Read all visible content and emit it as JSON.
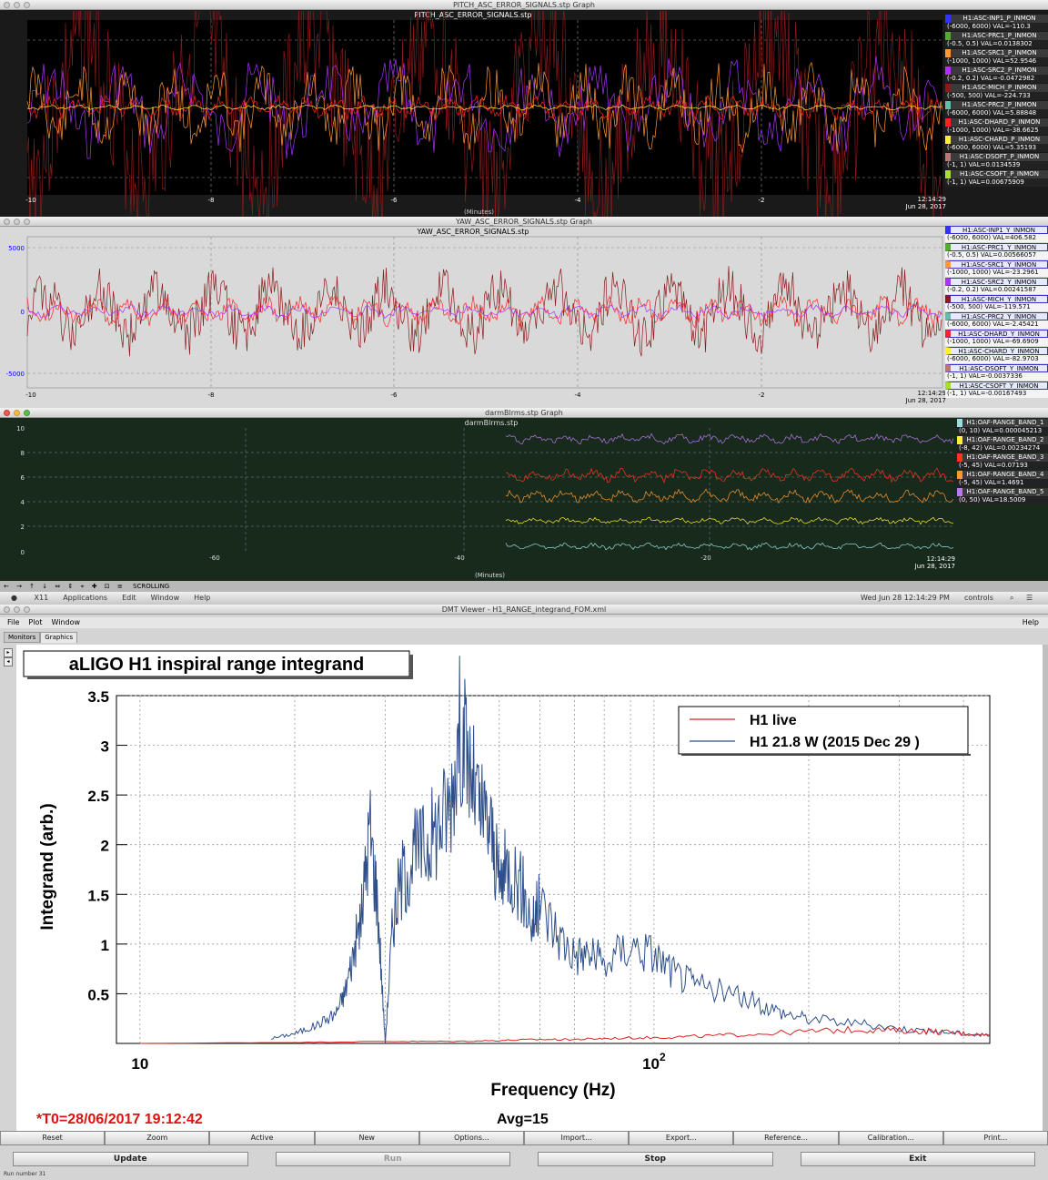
{
  "pitch_window": {
    "title": "PITCH_ASC_ERROR_SIGNALS.stp Graph",
    "plot_title": "PITCH_ASC_ERROR_SIGNALS.stp",
    "x_ticks": [
      "-10",
      "-8",
      "-6",
      "-4",
      "-2"
    ],
    "timestamp": "12:14:29",
    "date": "Jun 28, 2017",
    "x_unit": "(Minutes)",
    "legend": [
      {
        "name": "H1:ASC-INP1_P_INMON",
        "val": "(-6000, 6000) VAL=-110.3",
        "color": "#3333ff"
      },
      {
        "name": "H1:ASC-PRC1_P_INMON",
        "val": "(-0.5, 0.5) VAL=0.0138302",
        "color": "#55aa33"
      },
      {
        "name": "H1:ASC-SRC1_P_INMON",
        "val": "(-1000, 1000) VAL=52.9546",
        "color": "#ff9933"
      },
      {
        "name": "H1:ASC-SRC2_P_INMON",
        "val": "(-0.2, 0.2) VAL=-0.0472982",
        "color": "#aa33ff"
      },
      {
        "name": "H1:ASC-MICH_P_INMON",
        "val": "(-500, 500) VAL=-224.733",
        "color": "#8b1a1a"
      },
      {
        "name": "H1:ASC-PRC2_P_INMON",
        "val": "(-6000, 6000) VAL=5.88848",
        "color": "#66bbaa"
      },
      {
        "name": "H1:ASC-DHARD_P_INMON",
        "val": "(-1000, 1000) VAL=-38.6625",
        "color": "#ff2222"
      },
      {
        "name": "H1:ASC-CHARD_P_INMON",
        "val": "(-6000, 6000) VAL=5.35193",
        "color": "#ffee33"
      },
      {
        "name": "H1:ASC-DSOFT_P_INMON",
        "val": "(-1, 1) VAL=0.0134539",
        "color": "#bb7777"
      },
      {
        "name": "H1:ASC-CSOFT_P_INMON",
        "val": "(-1, 1) VAL=0.00675909",
        "color": "#aadd33"
      }
    ]
  },
  "yaw_window": {
    "title": "YAW_ASC_ERROR_SIGNALS.stp Graph",
    "plot_title": "YAW_ASC_ERROR_SIGNALS.stp",
    "y_ticks": [
      "5000",
      "0",
      "-5000"
    ],
    "x_ticks": [
      "-10",
      "-8",
      "-6",
      "-4",
      "-2"
    ],
    "timestamp": "12:14:29",
    "date": "Jun 28, 2017",
    "legend": [
      {
        "name": "H1:ASC-INP1_Y_INMON",
        "val": "(-6000, 6000) VAL=406.582",
        "color": "#3333ff"
      },
      {
        "name": "H1:ASC-PRC1_Y_INMON",
        "val": "(-0.5, 0.5) VAL=0.00566057",
        "color": "#55aa33"
      },
      {
        "name": "H1:ASC-SRC1_Y_INMON",
        "val": "(-1000, 1000) VAL=-23.2961",
        "color": "#ff9933"
      },
      {
        "name": "H1:ASC-SRC2_Y_INMON",
        "val": "(-0.2, 0.2) VAL=0.00241587",
        "color": "#aa33ff"
      },
      {
        "name": "H1:ASC-MICH_Y_INMON",
        "val": "(-500, 500) VAL=-119.571",
        "color": "#8b1a1a"
      },
      {
        "name": "H1:ASC-PRC2_Y_INMON",
        "val": "(-6000, 6000) VAL=-2.45421",
        "color": "#66bbaa"
      },
      {
        "name": "H1:ASC-DHARD_Y_INMON",
        "val": "(-1000, 1000) VAL=-69.6909",
        "color": "#ff2222"
      },
      {
        "name": "H1:ASC-CHARD_Y_INMON",
        "val": "(-6000, 6000) VAL=-82.9703",
        "color": "#ffee33"
      },
      {
        "name": "H1:ASC-DSOFT_Y_INMON",
        "val": "(-1, 1) VAL=-0.0037336",
        "color": "#bb7777"
      },
      {
        "name": "H1:ASC-CSOFT_Y_INMON",
        "val": "(-1, 1) VAL=-0.00167493",
        "color": "#aadd33"
      }
    ]
  },
  "darm_window": {
    "title": "darmBlrms.stp Graph",
    "plot_title": "darmBlrms.stp",
    "y_ticks": [
      "10",
      "8",
      "6",
      "4",
      "2",
      "0"
    ],
    "x_ticks": [
      "-60",
      "-40",
      "-20"
    ],
    "timestamp": "12:14:29",
    "date": "Jun 28, 2017",
    "x_unit": "(Minutes)",
    "legend": [
      {
        "name": "H1:OAF-RANGE_BAND_1",
        "val": "(0, 10) VAL=0.000045213",
        "color": "#99dddd"
      },
      {
        "name": "H1:OAF-RANGE_BAND_2",
        "val": "(-8, 42) VAL=0.00234274",
        "color": "#ffee33"
      },
      {
        "name": "H1:OAF-RANGE_BAND_3",
        "val": "(-5, 45) VAL=0.07193",
        "color": "#ff3322"
      },
      {
        "name": "H1:OAF-RANGE_BAND_4",
        "val": "(-5, 45) VAL=1.4691",
        "color": "#ff9933"
      },
      {
        "name": "H1:OAF-RANGE_BAND_5",
        "val": "(0, 50) VAL=18.5009",
        "color": "#bb77ee"
      }
    ],
    "toolbar_label": "SCROLLING"
  },
  "mac_menubar": {
    "items": [
      "X11",
      "Applications",
      "Edit",
      "Window",
      "Help"
    ],
    "clock": "Wed Jun 28 12:14:29 PM",
    "user": "controls"
  },
  "dmt_window": {
    "title": "DMT Viewer - H1_RANGE_integrand_FOM.xml",
    "menu": [
      "File",
      "Plot",
      "Window"
    ],
    "help": "Help",
    "tabs": [
      "Monitors",
      "Graphics"
    ],
    "plot_title": "aLIGO H1 inspiral range integrand",
    "xlabel": "Frequency (Hz)",
    "ylabel": "Integrand (arb.)",
    "t0": "*T0=28/06/2017 19:12:42",
    "avg": "Avg=15",
    "buttons_row1": [
      "Reset",
      "Zoom",
      "Active",
      "New",
      "Options...",
      "Import...",
      "Export...",
      "Reference...",
      "Calibration...",
      "Print..."
    ],
    "buttons_row2": [
      "Update",
      "Run",
      "Stop",
      "Exit"
    ],
    "status": "Run number 31"
  },
  "chart_data": {
    "type": "line",
    "title": "aLIGO H1 inspiral range integrand",
    "xlabel": "Frequency (Hz)",
    "ylabel": "Integrand (arb.)",
    "xscale": "log",
    "xlim": [
      9,
      450
    ],
    "ylim": [
      0,
      3.5
    ],
    "x_tick_labels": [
      "10",
      "10^2"
    ],
    "y_ticks": [
      0.5,
      1,
      1.5,
      2,
      2.5,
      3,
      3.5
    ],
    "legend_placement": "top-right",
    "grid": true,
    "series": [
      {
        "name": "H1 live",
        "color": "#dd2222",
        "x": [
          10,
          20,
          30,
          40,
          50,
          60,
          70,
          80,
          100,
          120,
          150,
          200,
          250,
          300,
          350,
          400,
          450
        ],
        "y": [
          0.0,
          0.01,
          0.02,
          0.02,
          0.03,
          0.04,
          0.04,
          0.05,
          0.06,
          0.07,
          0.09,
          0.12,
          0.14,
          0.13,
          0.12,
          0.1,
          0.08
        ]
      },
      {
        "name": "H1 21.8 W (2015 Dec 29 )",
        "color": "#2e4f8a",
        "x": [
          18,
          20,
          22,
          24,
          25,
          26,
          27,
          28,
          29,
          30,
          31,
          32,
          34,
          36,
          38,
          40,
          42,
          44,
          46,
          48,
          50,
          52,
          55,
          58,
          60,
          65,
          70,
          75,
          80,
          90,
          100,
          110,
          120,
          140,
          160,
          180,
          200,
          250,
          300,
          350,
          400,
          450
        ],
        "y": [
          0.05,
          0.1,
          0.18,
          0.3,
          0.5,
          0.9,
          1.3,
          2.2,
          1.4,
          0.0,
          1.2,
          1.6,
          1.9,
          2.0,
          2.2,
          2.4,
          3.2,
          2.7,
          2.3,
          2.2,
          1.6,
          1.8,
          1.6,
          1.2,
          1.4,
          1.1,
          0.9,
          0.9,
          0.8,
          1.0,
          0.9,
          0.7,
          0.6,
          0.5,
          0.4,
          0.3,
          0.25,
          0.2,
          0.15,
          0.12,
          0.1,
          0.08
        ]
      }
    ]
  }
}
